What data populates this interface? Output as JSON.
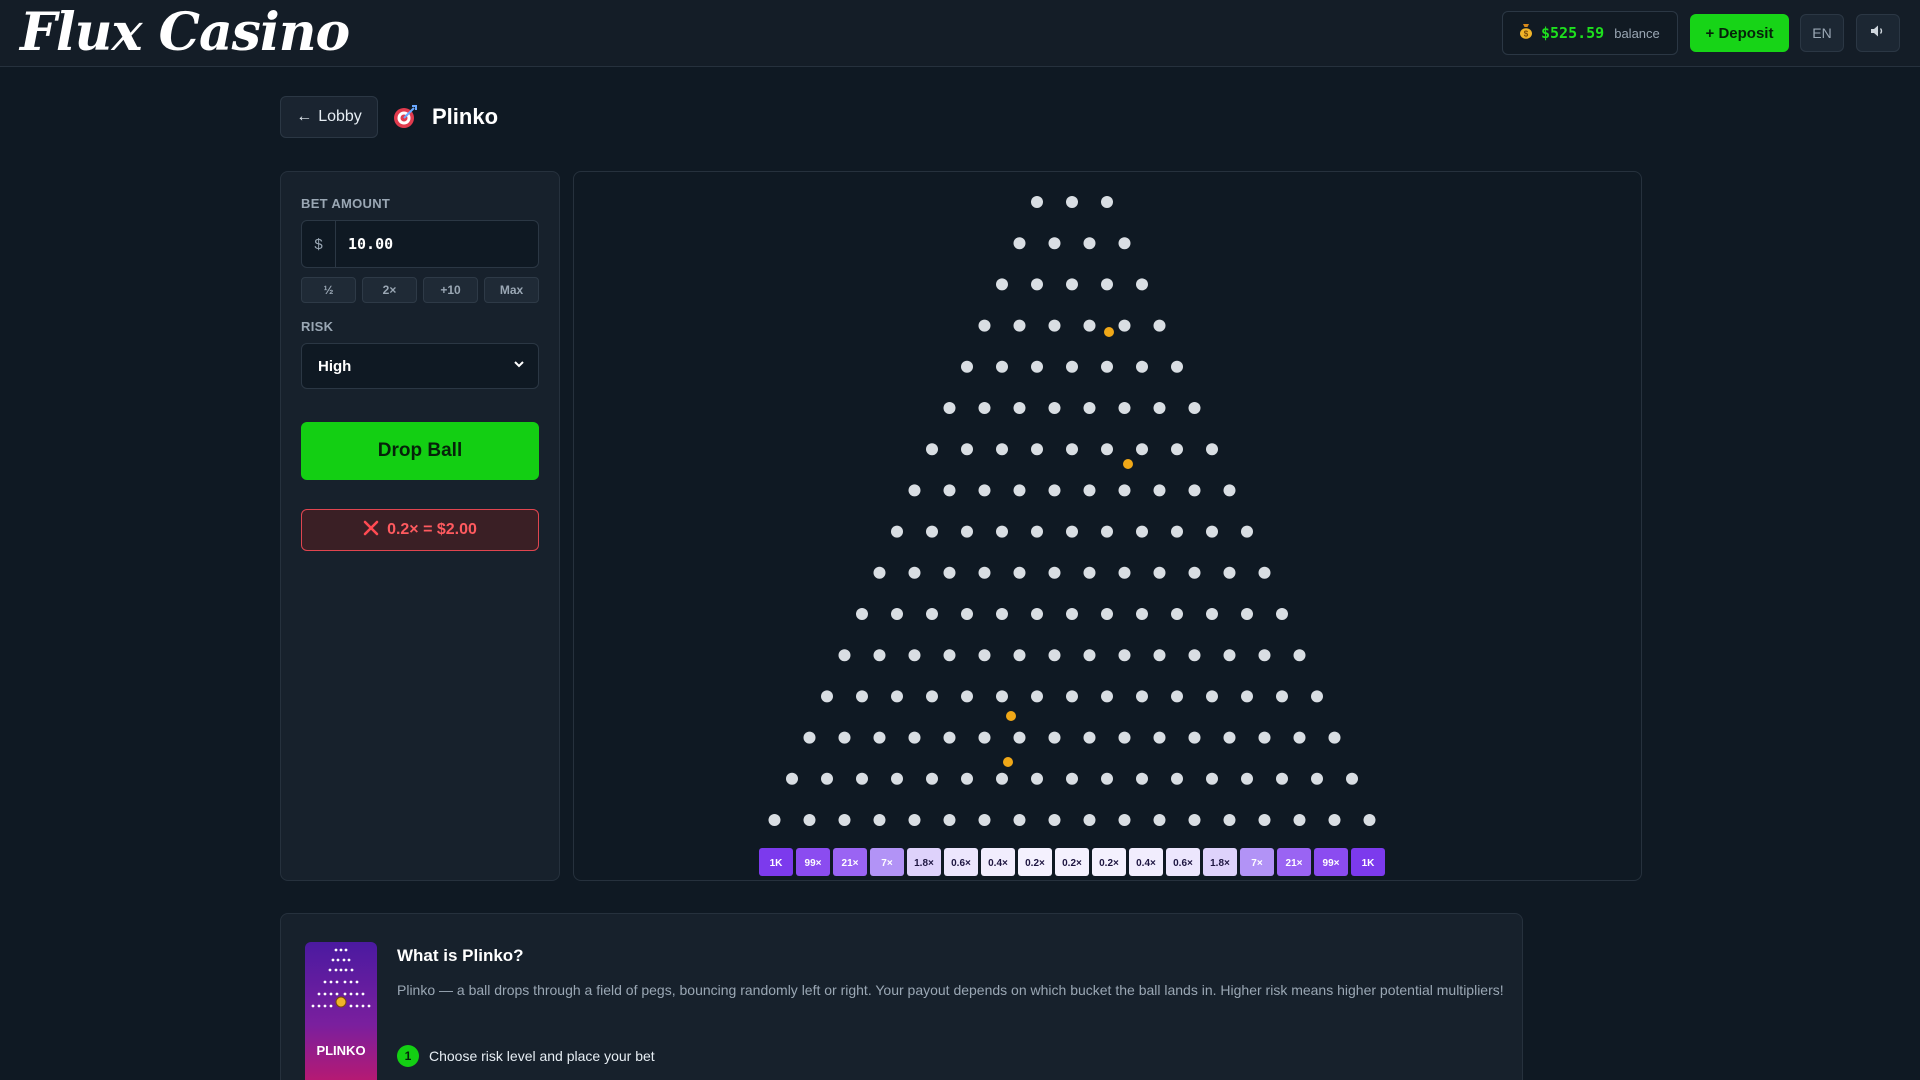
{
  "header": {
    "logo": "Flux Casino",
    "balance_amount": "$525.59",
    "balance_label": "balance",
    "deposit_label": "+ Deposit",
    "language": "EN"
  },
  "nav": {
    "back_label": "Lobby",
    "game_title": "Plinko"
  },
  "controls": {
    "bet_label": "BET AMOUNT",
    "currency": "$",
    "bet_value": "10.00",
    "quick_buttons": [
      "½",
      "2×",
      "+10",
      "Max"
    ],
    "risk_label": "RISK",
    "risk_value": "High",
    "drop_label": "Drop Ball",
    "last_result": "0.2× = $2.00"
  },
  "board": {
    "rows": 16,
    "buckets": [
      "1K",
      "99×",
      "21×",
      "7×",
      "1.8×",
      "0.6×",
      "0.4×",
      "0.2×",
      "0.2×",
      "0.2×",
      "0.4×",
      "0.6×",
      "1.8×",
      "7×",
      "21×",
      "99×",
      "1K"
    ],
    "bucket_colors": [
      "#7c3aed",
      "#8b4cf0",
      "#9a64f3",
      "#b293f6",
      "#ded2fb",
      "#ece6fd",
      "#f1edfd",
      "#f4f1fe",
      "#f4f1fe",
      "#f4f1fe",
      "#f1edfd",
      "#ece6fd",
      "#ded2fb",
      "#b293f6",
      "#9a64f3",
      "#8b4cf0",
      "#7c3aed"
    ],
    "peg_color": "#d9dee3",
    "ball_color": "#f0a818"
  },
  "info": {
    "thumb_label": "PLINKO",
    "title": "What is Plinko?",
    "description": "Plinko — a ball drops through a field of pegs, bouncing randomly left or right. Your payout depends on which bucket the ball lands in. Higher risk means higher potential multipliers!",
    "steps": [
      {
        "num": "1",
        "text": "Choose risk level and place your bet"
      }
    ]
  }
}
